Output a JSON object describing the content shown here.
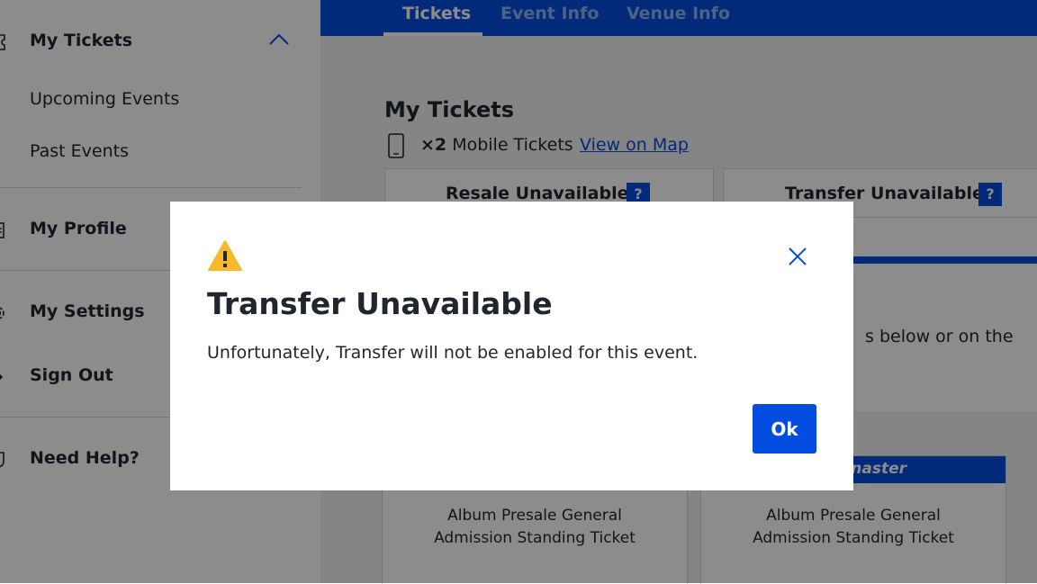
{
  "sidebar": {
    "my_tickets": "My Tickets",
    "upcoming_events": "Upcoming Events",
    "past_events": "Past Events",
    "my_profile": "My Profile",
    "my_settings": "My Settings",
    "sign_out": "Sign Out",
    "need_help": "Need Help?"
  },
  "topnav": {
    "tabs": [
      {
        "label": "Tickets",
        "active": true
      },
      {
        "label": "Event Info",
        "active": false
      },
      {
        "label": "Venue Info",
        "active": false
      }
    ]
  },
  "main": {
    "section_title": "My Tickets",
    "ticket_count": "×2",
    "ticket_type": "Mobile Tickets",
    "view_on_map": "View on Map",
    "resale_label": "Resale Unavailable",
    "transfer_label": "Transfer Unavailable",
    "help_badge": "?",
    "info_text_partial": "s below or on the",
    "tm_logo_partial": "naster",
    "tickets": [
      {
        "name_line1": "Album Presale General",
        "name_line2": "Admission Standing Ticket"
      },
      {
        "name_line1": "Album Presale General",
        "name_line2": "Admission Standing Ticket"
      }
    ]
  },
  "modal": {
    "title": "Transfer Unavailable",
    "body": "Unfortunately, Transfer will not be enabled for this event.",
    "ok_label": "Ok",
    "icon": "warning-icon"
  },
  "colors": {
    "brand_blue": "#024ddf",
    "warning_yellow": "#f5b92b",
    "text": "#1f262d"
  }
}
